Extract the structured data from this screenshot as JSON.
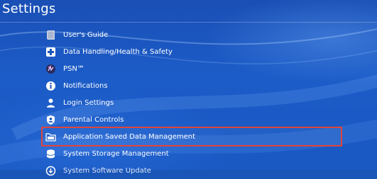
{
  "header": {
    "title": "Settings"
  },
  "menu": {
    "items": [
      {
        "label": "User's Guide",
        "icon": "book-icon"
      },
      {
        "label": "Data Handling/Health & Safety",
        "icon": "health-safety-icon"
      },
      {
        "label": "PSN℠",
        "icon": "psn-icon"
      },
      {
        "label": "Notifications",
        "icon": "info-icon"
      },
      {
        "label": "Login Settings",
        "icon": "login-icon"
      },
      {
        "label": "Parental Controls",
        "icon": "parental-controls-icon"
      },
      {
        "label": "Application Saved Data Management",
        "icon": "folder-icon",
        "selected": true
      },
      {
        "label": "System Storage Management",
        "icon": "storage-icon"
      },
      {
        "label": "System Software Update",
        "icon": "update-icon"
      }
    ]
  },
  "colors": {
    "background": "#1a55b8",
    "selection_outline": "#e0443b",
    "text": "#ffffff"
  }
}
